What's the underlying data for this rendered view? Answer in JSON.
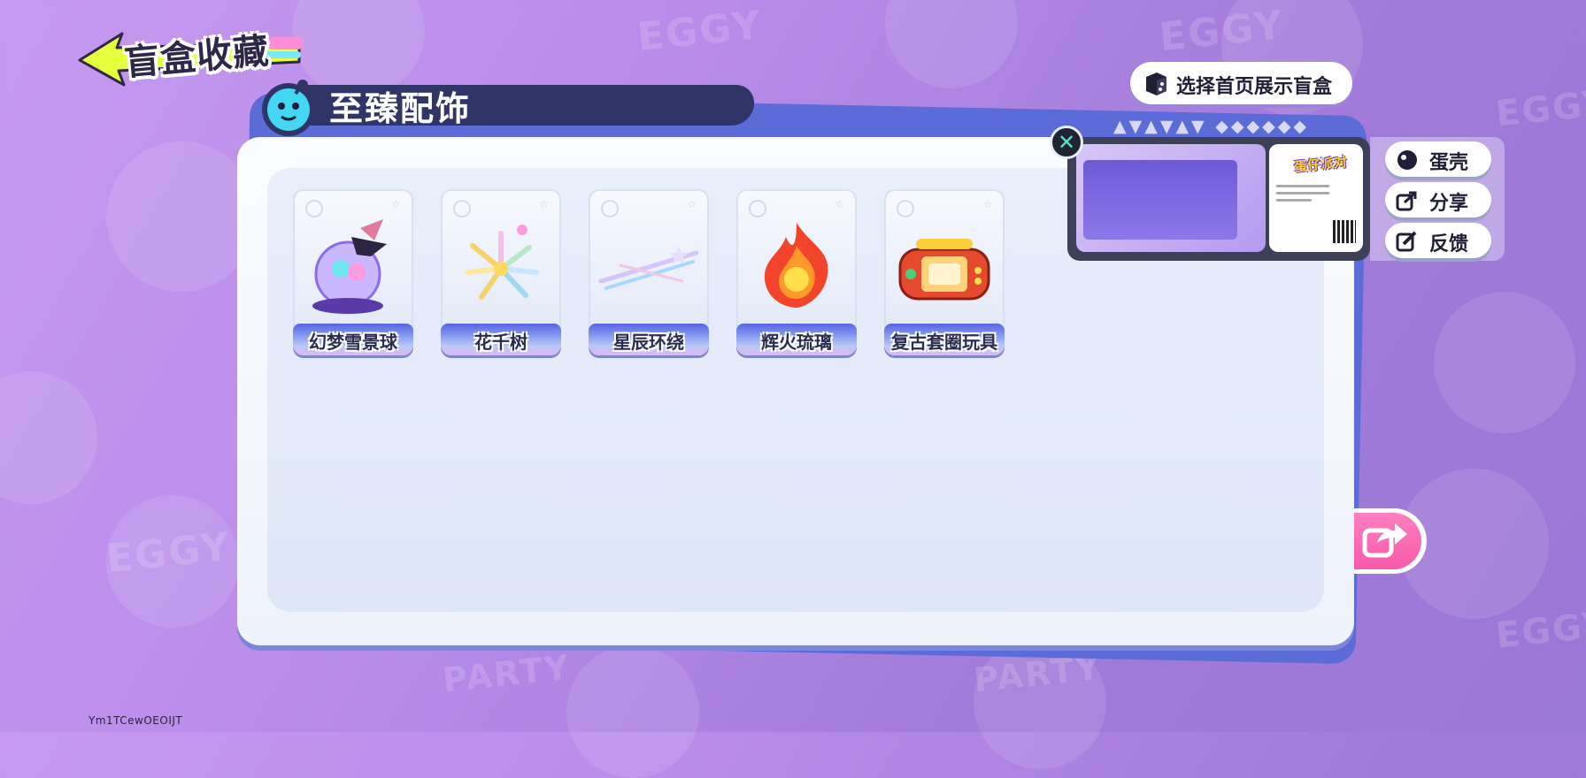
{
  "header": {
    "back_title": "盲盒收藏"
  },
  "category": {
    "title": "至臻配饰"
  },
  "choose_display": {
    "label": "选择首页展示盲盒"
  },
  "items": [
    {
      "name": "幻梦雪景球",
      "icon": "snow-globe-witch-hat"
    },
    {
      "name": "花千树",
      "icon": "flower-firework"
    },
    {
      "name": "星辰环绕",
      "icon": "star-ring"
    },
    {
      "name": "辉火琉璃",
      "icon": "fire-glass"
    },
    {
      "name": "复古套圈玩具",
      "icon": "retro-game-console"
    }
  ],
  "share_preview": {
    "title": "蛋仔派对"
  },
  "side_actions": [
    {
      "label": "蛋壳",
      "icon": "egg-shell-icon"
    },
    {
      "label": "分享",
      "icon": "share-icon"
    },
    {
      "label": "反馈",
      "icon": "feedback-icon"
    }
  ],
  "watermark": "Ym1TCewOEOIJT",
  "colors": {
    "background": "#b98ce9",
    "panel_accent": "#5b6cd8",
    "header_bar": "#2f3566",
    "share_pink": "#f65aa9"
  }
}
